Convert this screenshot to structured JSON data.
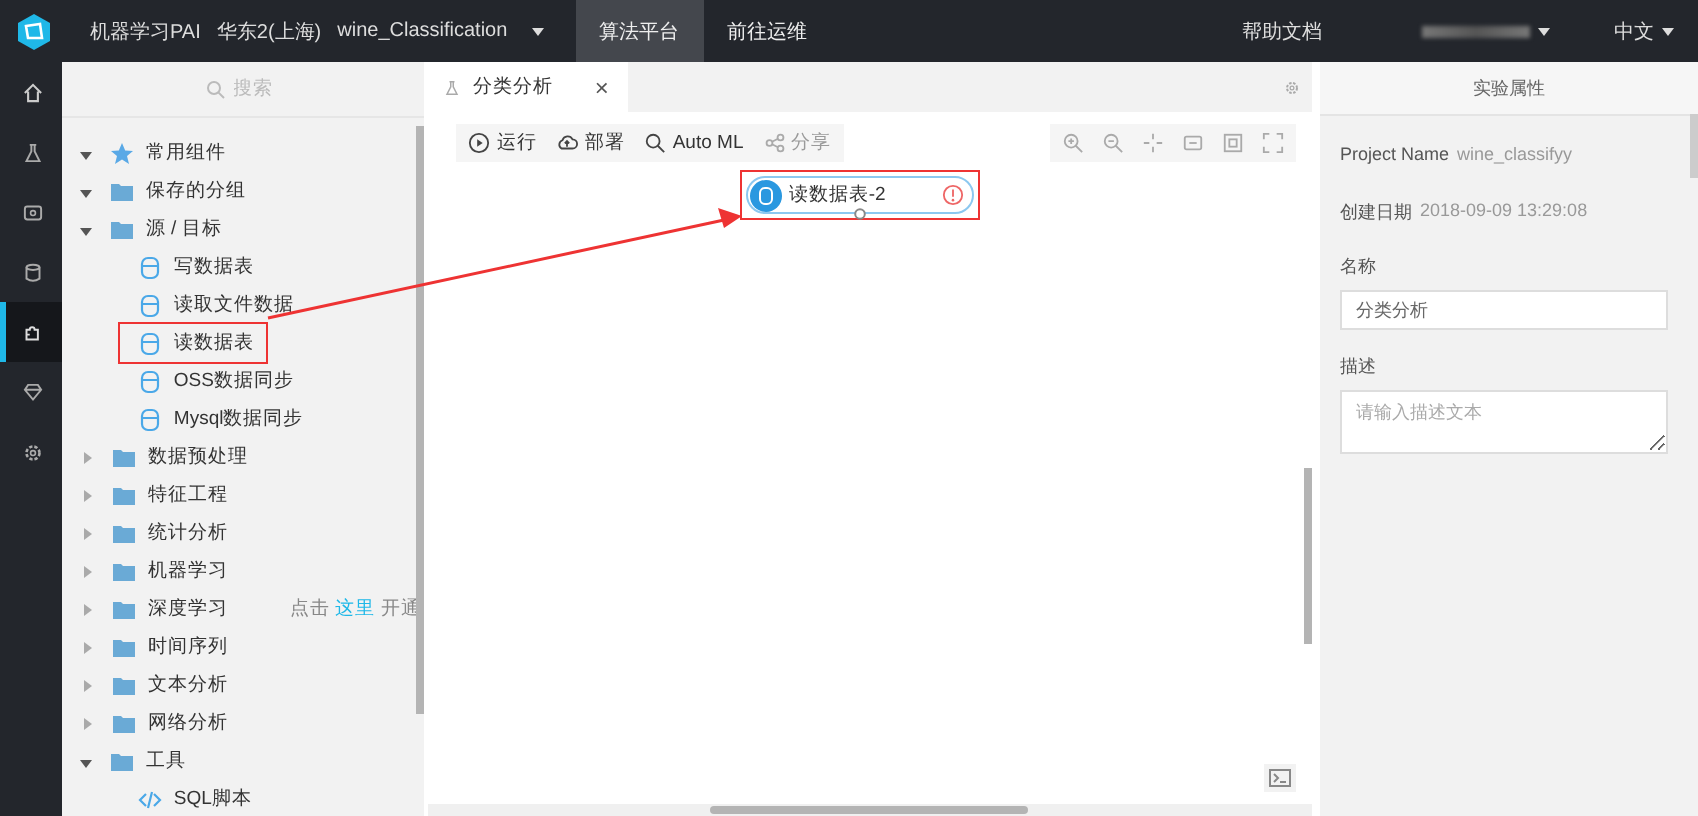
{
  "topbar": {
    "product": "机器学习PAI",
    "region": "华东2(上海)",
    "project": "wine_Classification",
    "nav": [
      {
        "label": "算法平台",
        "selected": true
      },
      {
        "label": "前往运维",
        "selected": false
      }
    ],
    "help": "帮助文档",
    "language": "中文"
  },
  "rail": [
    {
      "kind": "home",
      "selected": false
    },
    {
      "kind": "flask",
      "selected": false
    },
    {
      "kind": "monitor",
      "selected": false
    },
    {
      "kind": "database",
      "selected": false
    },
    {
      "kind": "puzzle",
      "selected": true
    },
    {
      "kind": "diamond",
      "selected": false
    },
    {
      "kind": "gear",
      "selected": false
    }
  ],
  "sidebar": {
    "search_placeholder": "搜索",
    "hint": {
      "before": "点击",
      "link": "这里",
      "after": "开通"
    },
    "items": [
      {
        "label": "常用组件",
        "kind": "star",
        "expanded": true
      },
      {
        "label": "保存的分组",
        "kind": "folder",
        "expanded": true
      },
      {
        "label": "源 / 目标",
        "kind": "folder",
        "expanded": true,
        "children": [
          {
            "label": "写数据表",
            "kind": "table",
            "highlighted": false
          },
          {
            "label": "读取文件数据",
            "kind": "table",
            "highlighted": false
          },
          {
            "label": "读数据表",
            "kind": "table",
            "highlighted": true
          },
          {
            "label": "OSS数据同步",
            "kind": "table",
            "highlighted": false
          },
          {
            "label": "Mysql数据同步",
            "kind": "table",
            "highlighted": false
          }
        ]
      },
      {
        "label": "数据预处理",
        "kind": "folder",
        "expanded": false
      },
      {
        "label": "特征工程",
        "kind": "folder",
        "expanded": false
      },
      {
        "label": "统计分析",
        "kind": "folder",
        "expanded": false
      },
      {
        "label": "机器学习",
        "kind": "folder",
        "expanded": false
      },
      {
        "label": "深度学习",
        "kind": "folder",
        "expanded": false
      },
      {
        "label": "时间序列",
        "kind": "folder",
        "expanded": false
      },
      {
        "label": "文本分析",
        "kind": "folder",
        "expanded": false
      },
      {
        "label": "网络分析",
        "kind": "folder",
        "expanded": false
      },
      {
        "label": "工具",
        "kind": "folder",
        "expanded": true,
        "children": [
          {
            "label": "SQL脚本",
            "kind": "code",
            "highlighted": false
          }
        ]
      }
    ]
  },
  "canvas": {
    "tab": "分类分析",
    "tab_close": "×",
    "toolbar": [
      {
        "kind": "run",
        "label": "运行",
        "disabled": false
      },
      {
        "kind": "deploy",
        "label": "部署",
        "disabled": false
      },
      {
        "kind": "automl",
        "label": "Auto ML",
        "disabled": false
      },
      {
        "kind": "share",
        "label": "分享",
        "disabled": true
      }
    ],
    "node": {
      "label": "读数据表-2",
      "highlighted": true
    }
  },
  "properties": {
    "title": "实验属性",
    "project_label": "Project Name",
    "project_value": "wine_classifyy",
    "created_label": "创建日期",
    "created_value": "2018-09-09 13:29:08",
    "name_label": "名称",
    "name_value": "分类分析",
    "desc_label": "描述",
    "desc_placeholder": "请输入描述文本"
  }
}
